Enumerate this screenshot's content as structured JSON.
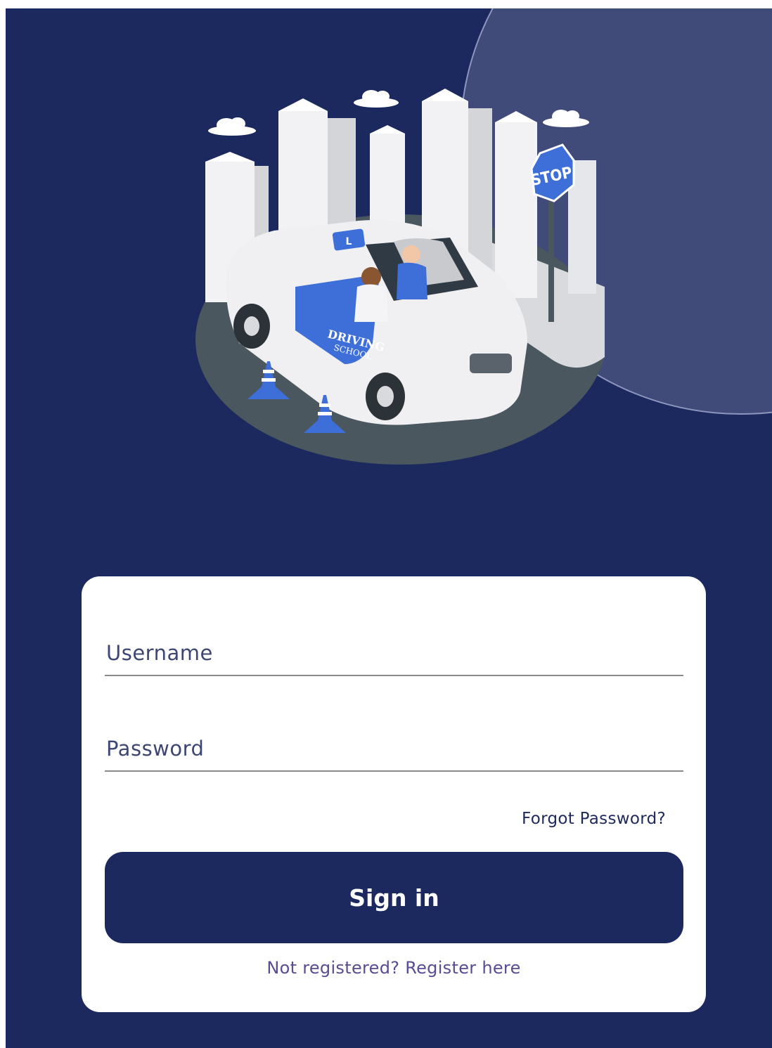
{
  "illustration": {
    "car_label_line1": "DRIVING",
    "car_label_line2": "SCHOOL",
    "roof_sign": "L",
    "stop_sign": "STOP"
  },
  "form": {
    "username_placeholder": "Username",
    "password_placeholder": "Password",
    "forgot_label": "Forgot Password?",
    "signin_label": "Sign in",
    "register_label": "Not registered? Register here"
  },
  "colors": {
    "background": "#1b295e",
    "accent_circle": "#404b79",
    "card": "#ffffff",
    "button": "#1b295e",
    "link": "#5b4b93"
  }
}
